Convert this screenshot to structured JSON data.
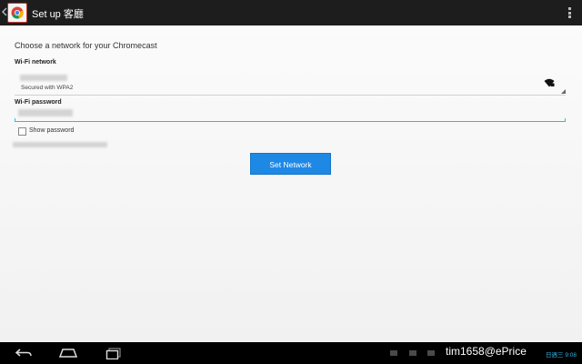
{
  "actionbar": {
    "title": "Set up 客廳",
    "back_icon": "chevron-left-icon",
    "app_icon": "chrome-icon",
    "overflow_icon": "more-vert-icon"
  },
  "form": {
    "heading": "Choose a network for your Chromecast",
    "wifi_label": "Wi-Fi network",
    "wifi_security": "Secured with WPA2",
    "password_label": "Wi-Fi password",
    "show_password": "Show password",
    "show_password_checked": false,
    "submit_label": "Set Network"
  },
  "navbar": {
    "back_icon": "nav-back-icon",
    "home_icon": "nav-home-icon",
    "recents_icon": "nav-recents-icon",
    "watermark": "tim1658@ePrice",
    "clock": "日週三 9:08"
  },
  "colors": {
    "accent": "#33b5e5",
    "button": "#1e88e5",
    "actionbar": "#1d1d1d"
  }
}
